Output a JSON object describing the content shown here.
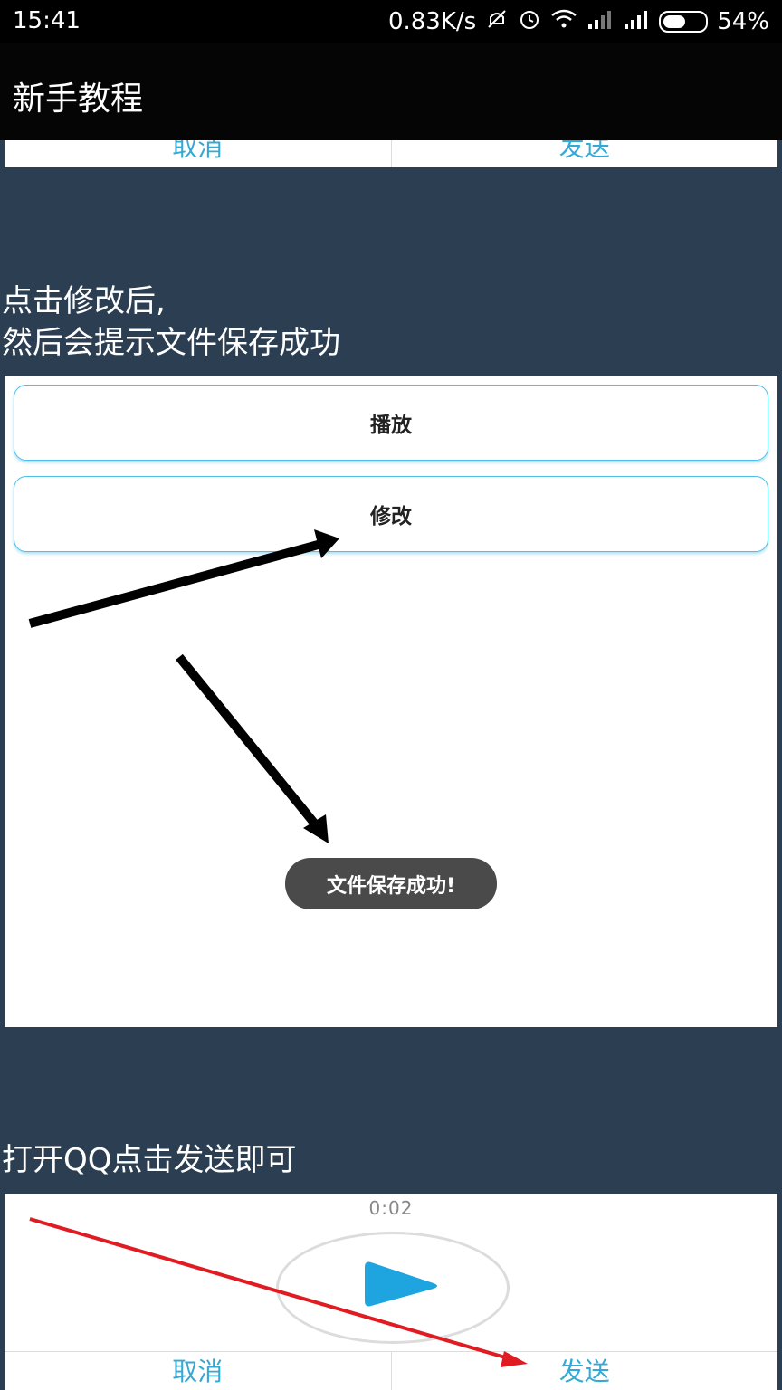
{
  "status": {
    "time": "15:41",
    "speed": "0.83K/s",
    "battery": "54%",
    "battery_level": 0.54
  },
  "appbar": {
    "title": "新手教程"
  },
  "top_panel": {
    "cancel": "取消",
    "send": "发送"
  },
  "step1": {
    "caption_line1": "点击修改后,",
    "caption_line2": "然后会提示文件保存成功",
    "play_label": "播放",
    "edit_label": "修改",
    "toast": "文件保存成功!"
  },
  "step2": {
    "caption": "打开QQ点击发送即可",
    "timer": "0:02",
    "cancel": "取消",
    "send": "发送"
  },
  "colors": {
    "background": "#2b3e52",
    "accent": "#33a9d6",
    "play_icon": "#1ea5e0",
    "arrow_red": "#e01b22"
  },
  "icons": [
    "mute-icon",
    "alarm-icon",
    "wifi-icon",
    "signal-icon",
    "battery-icon",
    "play-icon",
    "arrow-annotation"
  ]
}
